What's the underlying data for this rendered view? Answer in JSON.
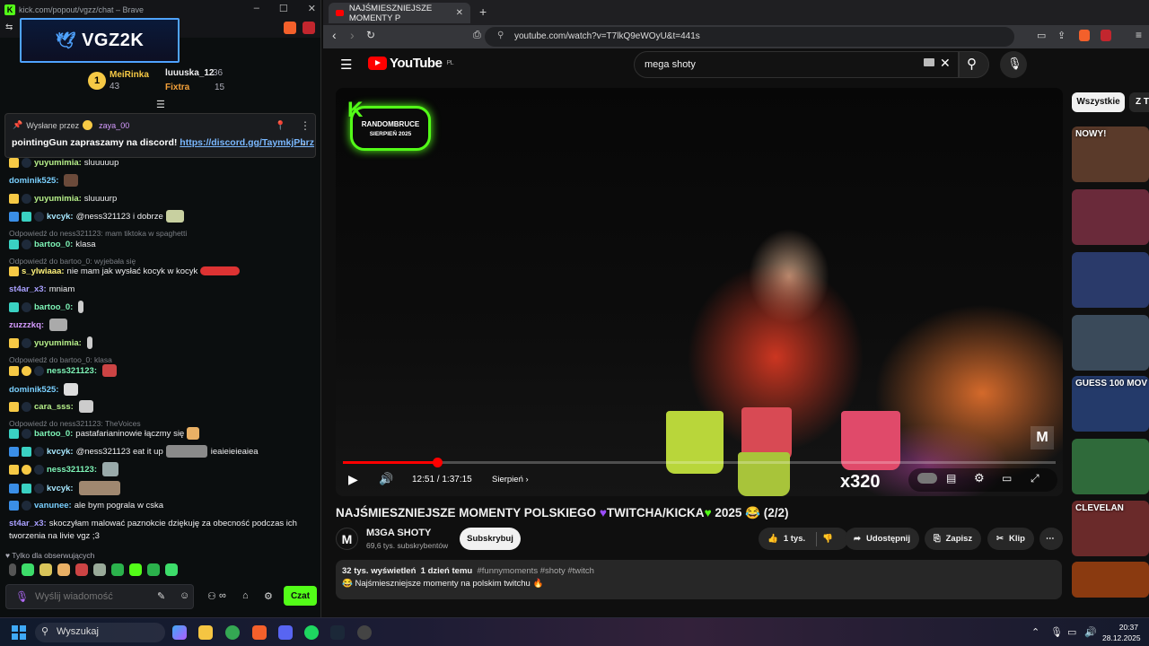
{
  "kick_window": {
    "title": "kick.com/popout/vgzz/chat – Brave",
    "banner": "VGZ2K",
    "leaderboard": [
      {
        "name": "MeiRinka",
        "value": "43",
        "color": "#f6c945"
      },
      {
        "name": "luuuska_12",
        "value": "36",
        "color": "#efeff1"
      },
      {
        "name": "Fixtra",
        "value": "15",
        "color": "#f6a23a"
      }
    ],
    "pinned": {
      "sent_by_label": "Wysłane przez",
      "sender": "zaya_00",
      "message": "pointingGun zapraszamy na discord!",
      "link": "https://discord.gg/TaymkjPhrz"
    },
    "messages": [
      {
        "user": "yuyumimia:",
        "text": "sluuuuup",
        "color": "#b7f08a"
      },
      {
        "user": "dominik525:",
        "text": "",
        "color": "#7ad0ff"
      },
      {
        "user": "yuyumimia:",
        "text": "sluuuurp",
        "color": "#b7f08a"
      },
      {
        "user": "kvcyk:",
        "text": "@ness321123 i dobrze",
        "color": "#a7e8ff"
      },
      {
        "user": "bartoo_0:",
        "text": "klasa",
        "color": "#7ef5b7"
      },
      {
        "user": "s_ylwiaaa:",
        "text": "nie mam jak wysłać kocyk w kocyk",
        "color": "#fff27a"
      },
      {
        "user": "st4ar_x3:",
        "text": "mniam",
        "color": "#a9a0ff"
      },
      {
        "user": "bartoo_0:",
        "text": "",
        "color": "#7ef5b7"
      },
      {
        "user": "zuzzzkq:",
        "text": "",
        "color": "#d59bff"
      },
      {
        "user": "yuyumimia:",
        "text": "",
        "color": "#b7f08a"
      },
      {
        "user": "ness321123:",
        "text": "",
        "color": "#7ef5b7"
      },
      {
        "user": "dominik525:",
        "text": "",
        "color": "#7ad0ff"
      },
      {
        "user": "cara_sss:",
        "text": "",
        "color": "#b7f08a"
      },
      {
        "user": "bartoo_0:",
        "text": "pastafarianinowie łączmy się",
        "color": "#7ef5b7"
      },
      {
        "user": "kvcyk:",
        "text": "@ness321123 eat it up",
        "color": "#a7e8ff"
      },
      {
        "user": "ness321123:",
        "text": "",
        "color": "#7ef5b7"
      },
      {
        "user": "kvcyk:",
        "text": "",
        "color": "#a7e8ff"
      },
      {
        "user": "vanunee:",
        "text": "ale bym pograla w cska",
        "color": "#7ad0ff"
      },
      {
        "user": "st4ar_x3:",
        "text": "skoczyłam malować paznokcie dziękuję za obecność podczas ich",
        "color": "#a9a0ff"
      },
      {
        "user": "",
        "text": "tworzenia na livie vgz ;3",
        "color": "#efeff1"
      }
    ],
    "replies": [
      "Odpowiedź do ness321123: mam tiktoka w spaghetti",
      "Odpowiedź do bartoo_0: wyjebała się",
      "Odpowiedź do bartoo_0: klasa",
      "Odpowiedź do ness321123: TheVoices"
    ],
    "kvcyk_suffix": "ieaieieieaiea",
    "followers_only": "Tylko dla obserwujących",
    "input_placeholder": "Wyślij wiadomość",
    "send_label": "Czat"
  },
  "browser": {
    "tab_title": "NAJŚMIESZNIEJSZE MOMENTY P",
    "url": "youtube.com/watch?v=T7lkQ9eWOyU&t=441s",
    "yt_region": "PL",
    "yt_logo_text": "YouTube",
    "search_value": "mega shoty"
  },
  "video": {
    "badge_name": "RANDOMBRUCE",
    "badge_date": "SIERPIEŃ 2025",
    "watermark": "M",
    "time_current": "12:51",
    "time_total": "1:37:15",
    "chapter": "Sierpień",
    "overlay_text": "x320",
    "progress": 0.132,
    "title_part1": "NAJŚMIESZNIEJSZE MOMENTY POLSKIEGO",
    "title_part2": "TWITCHA/KICKA",
    "title_part3": "2025",
    "title_part4": "(2/2)",
    "channel": "M3GA SHOTY",
    "subscribers": "69,6 tys. subskrybentów",
    "subscribe_label": "Subskrybuj",
    "likes": "1 tys.",
    "share_label": "Udostępnij",
    "save_label": "Zapisz",
    "clip_label": "Klip",
    "views": "32 tys. wyświetleń",
    "age": "1 dzień temu",
    "tags": "#funnymoments #shoty #twitch",
    "description": "Najśmieszniejsze momenty na polskim twitchu"
  },
  "sidebar": {
    "chip_all": "Wszystkie",
    "chip_next": "Z T",
    "thumbs": [
      {
        "caption": "NOWY!",
        "color": "#5a3a2a"
      },
      {
        "caption": "",
        "color": "#6a2a3a"
      },
      {
        "caption": "",
        "color": "#2a3a6a"
      },
      {
        "caption": "",
        "color": "#3a4a5a"
      },
      {
        "caption": "GUESS 100 MOV",
        "color": "#243a6a"
      },
      {
        "caption": "",
        "color": "#2f6a3a"
      },
      {
        "caption": "CLEVELAN",
        "color": "#6a2a2a"
      },
      {
        "caption": "",
        "color": "#8a3a10"
      }
    ]
  },
  "taskbar": {
    "search_label": "Wyszukaj",
    "time": "20:37",
    "date": "28.12.2025"
  }
}
